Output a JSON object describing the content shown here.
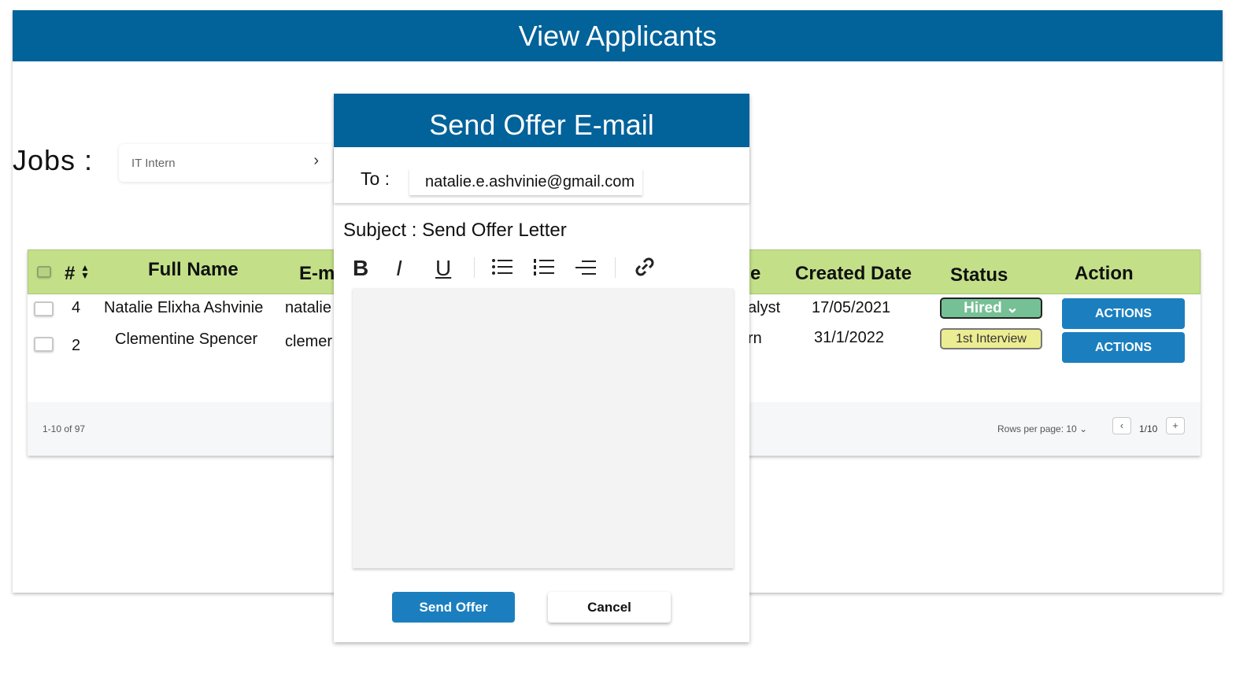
{
  "page": {
    "title": "View Applicants"
  },
  "filter": {
    "label": "Jobs :",
    "selected_job": "IT Intern"
  },
  "table": {
    "columns": [
      "#",
      "Full Name",
      "E-m",
      "e",
      "Created Date",
      "Status",
      "Action"
    ],
    "rows": [
      {
        "num": "4",
        "full_name": "Natalie Elixha Ashvinie",
        "email": "natalie",
        "job": "alyst",
        "created": "17/05/2021",
        "status": "Hired",
        "action": "ACTIONS"
      },
      {
        "num": "2",
        "full_name": "Clementine Spencer",
        "email": "clemer",
        "job": "rn",
        "created": "31/1/2022",
        "status": "1st Interview",
        "action": "ACTIONS"
      }
    ],
    "footer": {
      "range": "1-10 of 97",
      "rows_per_page": "Rows per page: 10",
      "page": "1/10"
    }
  },
  "colors": {
    "header_blue": "#02629a",
    "table_header_green": "#c3e089",
    "button_blue": "#1b7fbf",
    "hired_green": "#76c095",
    "interview_yellow": "#ecec93"
  },
  "modal": {
    "title": "Send Offer E-mail",
    "to_label": "To :",
    "to_value": "natalie.e.ashvinie@gmail.com",
    "subject_label": "Subject :",
    "subject_value": "Send Offer Letter",
    "toolbar": [
      "bold-icon",
      "italic-icon",
      "underline-icon",
      "bulleted-list-icon",
      "numbered-list-icon",
      "align-right-icon",
      "link-icon"
    ],
    "send_label": "Send Offer",
    "cancel_label": "Cancel"
  }
}
